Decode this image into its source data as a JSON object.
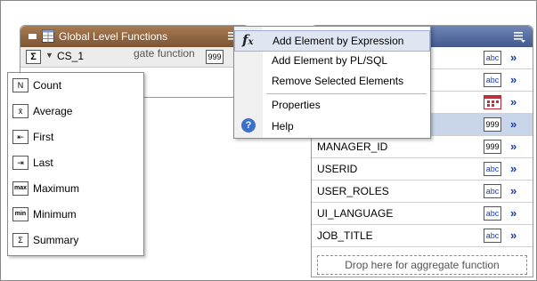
{
  "left_panel": {
    "title": "Global Level Functions",
    "cs_label": "CS_1",
    "cs_type_badge": "999",
    "drop_hint_partial": "gate function"
  },
  "aggregate_menu": {
    "items": [
      {
        "label": "Count",
        "icon": "count-icon",
        "glyph": "N"
      },
      {
        "label": "Average",
        "icon": "average-icon",
        "glyph": "x̄"
      },
      {
        "label": "First",
        "icon": "first-icon",
        "glyph": "⇤"
      },
      {
        "label": "Last",
        "icon": "last-icon",
        "glyph": "⇥"
      },
      {
        "label": "Maximum",
        "icon": "maximum-icon",
        "glyph": "max"
      },
      {
        "label": "Minimum",
        "icon": "minimum-icon",
        "glyph": "min"
      },
      {
        "label": "Summary",
        "icon": "summary-icon",
        "glyph": "Σ"
      }
    ]
  },
  "context_menu": {
    "items": [
      {
        "label": "Add Element by Expression",
        "icon": "fx-icon"
      },
      {
        "label": "Add Element by PL/SQL"
      },
      {
        "label": "Remove Selected Elements"
      },
      {
        "label": "Properties"
      },
      {
        "label": "Help",
        "icon": "help-icon"
      }
    ]
  },
  "right_panel": {
    "rows": [
      {
        "name": "",
        "type": "abc"
      },
      {
        "name": "",
        "type": "abc"
      },
      {
        "name": "",
        "type": "date"
      },
      {
        "name": "",
        "type": "999",
        "selected": true
      },
      {
        "name": "MANAGER_ID",
        "type": "999"
      },
      {
        "name": "USERID",
        "type": "abc"
      },
      {
        "name": "USER_ROLES",
        "type": "abc"
      },
      {
        "name": "UI_LANGUAGE",
        "type": "abc"
      },
      {
        "name": "JOB_TITLE",
        "type": "abc"
      }
    ],
    "drop_hint": "Drop here for aggregate function",
    "row_arrow": "»"
  },
  "colors": {
    "left_header": "#8a6140",
    "right_header": "#4f659b",
    "selected_row": "#c9d6ea",
    "menu_highlight": "#dfe6f2"
  }
}
